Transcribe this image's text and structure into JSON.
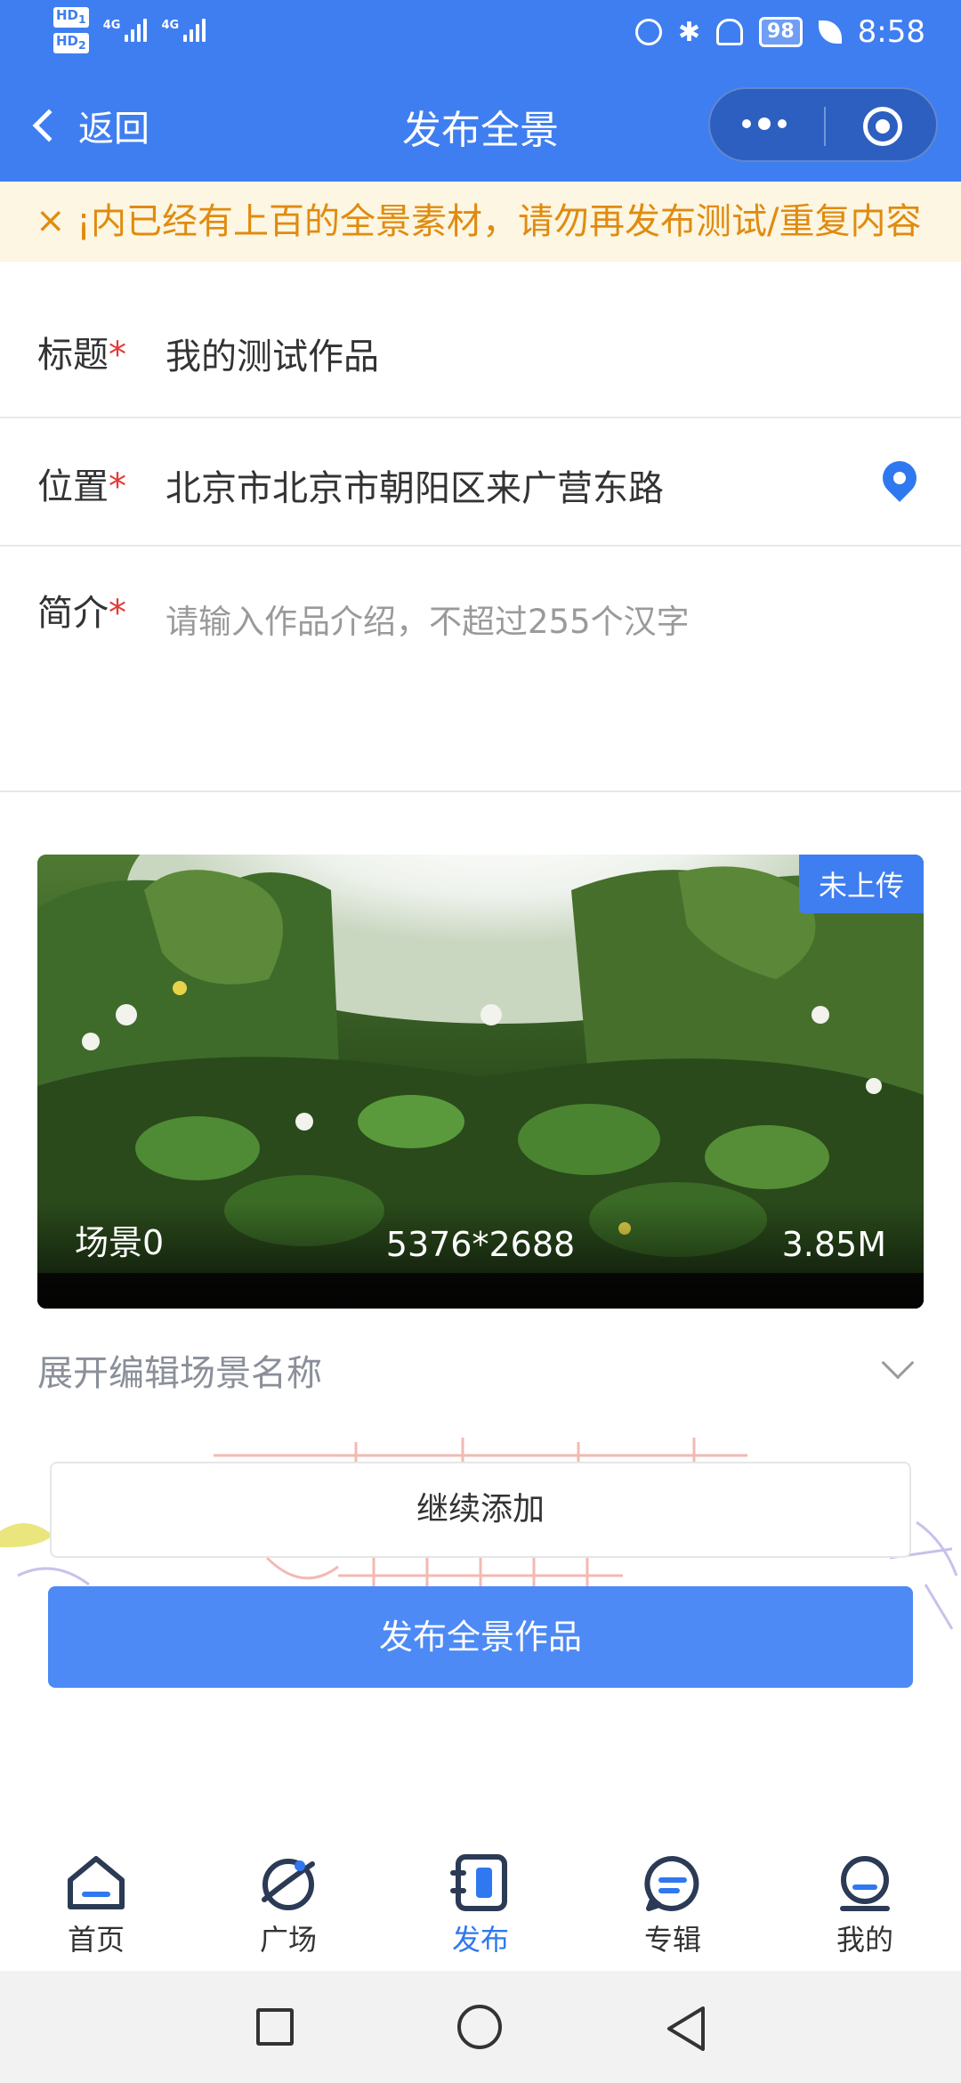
{
  "status_bar": {
    "hd1": "HD",
    "hd1_sub": "1",
    "hd2": "HD",
    "hd2_sub": "2",
    "net1": "4G",
    "net2": "4G",
    "battery": "98",
    "time": "8:58"
  },
  "nav": {
    "back_label": "返回",
    "title": "发布全景"
  },
  "notice": {
    "close": "×",
    "text": "¡内已经有上百的全景素材，请勿再发布测试/重复内容"
  },
  "form": {
    "title_label": "标题",
    "title_value": "我的测试作品",
    "location_label": "位置",
    "location_value": "北京市北京市朝阳区来广营东路",
    "intro_label": "简介",
    "intro_placeholder": "请输入作品介绍，不超过255个汉字",
    "required_mark": "*"
  },
  "scene": {
    "status": "未上传",
    "name": "场景0",
    "resolution": "5376*2688",
    "size": "3.85M"
  },
  "expand_label": "展开编辑场景名称",
  "buttons": {
    "add": "继续添加",
    "publish": "发布全景作品"
  },
  "tabs": [
    {
      "label": "首页",
      "icon": "home-icon"
    },
    {
      "label": "广场",
      "icon": "planet-icon"
    },
    {
      "label": "发布",
      "icon": "publish-icon",
      "active": true
    },
    {
      "label": "专辑",
      "icon": "album-icon"
    },
    {
      "label": "我的",
      "icon": "profile-icon"
    }
  ],
  "colors": {
    "primary": "#3f7ef0",
    "notice_bg": "#fcf6e2",
    "notice_text": "#e08b10",
    "required": "#e53935"
  }
}
